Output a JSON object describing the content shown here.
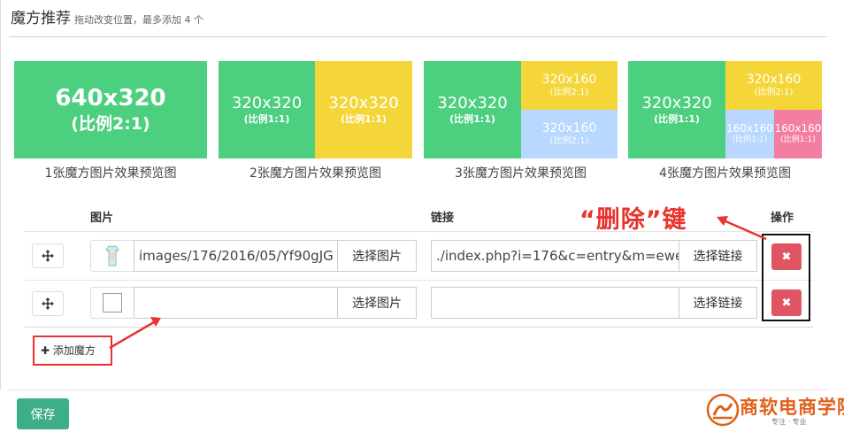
{
  "header": {
    "title": "魔方推荐",
    "subtitle": "拖动改变位置，最多添加 4 个"
  },
  "previews": [
    {
      "caption": "1张魔方图片效果预览图",
      "blocks": [
        {
          "size": "640x320",
          "ratio": "(比例2:1)"
        }
      ]
    },
    {
      "caption": "2张魔方图片效果预览图",
      "blocks": [
        {
          "size": "320x320",
          "ratio": "(比例1:1)"
        },
        {
          "size": "320x320",
          "ratio": "(比例1:1)"
        }
      ]
    },
    {
      "caption": "3张魔方图片效果预览图",
      "blocks": [
        {
          "size": "320x320",
          "ratio": "(比例1:1)"
        },
        {
          "size": "320x160",
          "ratio": "(比例2:1)"
        },
        {
          "size": "320x160",
          "ratio": "(比例2:1)"
        }
      ]
    },
    {
      "caption": "4张魔方图片效果预览图",
      "blocks": [
        {
          "size": "320x320",
          "ratio": "(比例1:1)"
        },
        {
          "size": "320x160",
          "ratio": "(比例2:1)"
        },
        {
          "size": "160x160",
          "ratio": "(比例1:1)"
        },
        {
          "size": "160x160",
          "ratio": "(比例1:1)"
        }
      ]
    }
  ],
  "table": {
    "col_image": "图片",
    "col_link": "链接",
    "col_action": "操作",
    "rows": [
      {
        "image_path": "images/176/2016/05/Yf90gJG",
        "select_image_label": "选择图片",
        "link_value": "./index.php?i=176&c=entry&m=ewe",
        "select_link_label": "选择链接",
        "move_icon": "move-icon",
        "delete_icon": "close-icon"
      },
      {
        "image_path": "",
        "select_image_label": "选择图片",
        "link_value": "",
        "select_link_label": "选择链接",
        "move_icon": "move-icon",
        "delete_icon": "close-icon"
      }
    ]
  },
  "add_button_label": "添加魔方",
  "annotation_text": "“删除”键",
  "save_label": "保存",
  "logo": {
    "text": "商软电商学院",
    "tagline": "专注 · 专业"
  },
  "colors": {
    "green": "#4dcf80",
    "yellow": "#f4d639",
    "blue": "#b8d8ff",
    "pink": "#f47ea0",
    "delete_red": "#e05563",
    "save_green": "#3eae88",
    "annotation_red": "#e8332e"
  }
}
